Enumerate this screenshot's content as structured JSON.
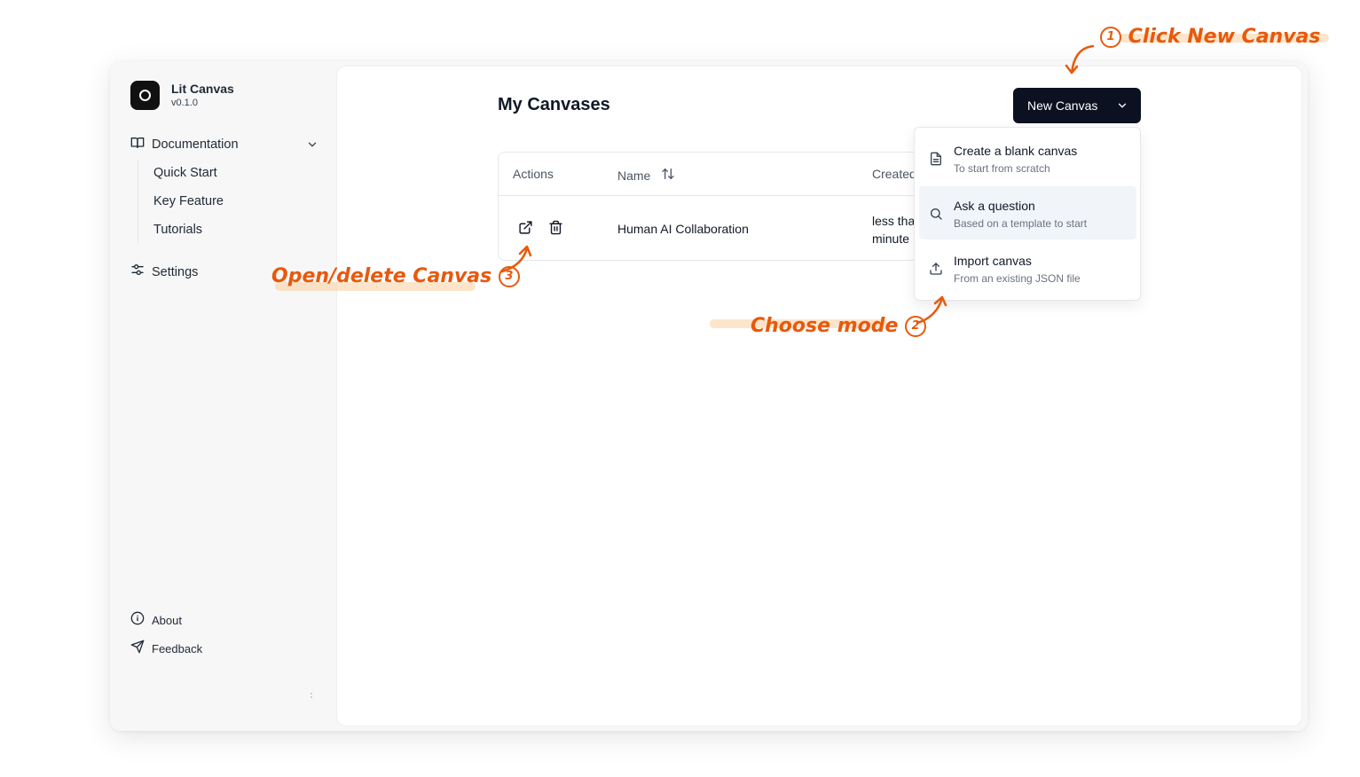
{
  "app": {
    "name": "Lit Canvas",
    "version": "v0.1.0"
  },
  "sidebar": {
    "documentation": {
      "label": "Documentation",
      "icon": "book-open-icon"
    },
    "doc_items": [
      {
        "label": "Quick Start"
      },
      {
        "label": "Key Feature"
      },
      {
        "label": "Tutorials"
      }
    ],
    "settings": {
      "label": "Settings",
      "icon": "sliders-icon"
    },
    "about": {
      "label": "About",
      "icon": "info-icon"
    },
    "feedback": {
      "label": "Feedback",
      "icon": "send-icon"
    }
  },
  "main": {
    "title": "My Canvases",
    "new_button": {
      "label": "New Canvas"
    },
    "table": {
      "headers": {
        "actions": "Actions",
        "name": "Name",
        "created": "Created"
      },
      "rows": [
        {
          "name": "Human AI Collaboration",
          "created_line1": "less than",
          "created_line2": "minute"
        }
      ]
    },
    "dropdown": {
      "items": [
        {
          "title": "Create a blank canvas",
          "subtitle": "To start from scratch",
          "icon": "file-text-icon"
        },
        {
          "title": "Ask a question",
          "subtitle": "Based on a template to start",
          "icon": "search-icon"
        },
        {
          "title": "Import canvas",
          "subtitle": "From an existing JSON file",
          "icon": "upload-icon"
        }
      ]
    }
  },
  "annotations": {
    "step1": {
      "num": "1",
      "text": "Click New Canvas"
    },
    "step2": {
      "num": "2",
      "text": "Choose mode"
    },
    "step3": {
      "num": "3",
      "text": "Open/delete Canvas"
    }
  },
  "colors": {
    "annotation": "#e8590c",
    "button_bg": "#0b1120",
    "highlight_row": "#f1f5f9"
  }
}
